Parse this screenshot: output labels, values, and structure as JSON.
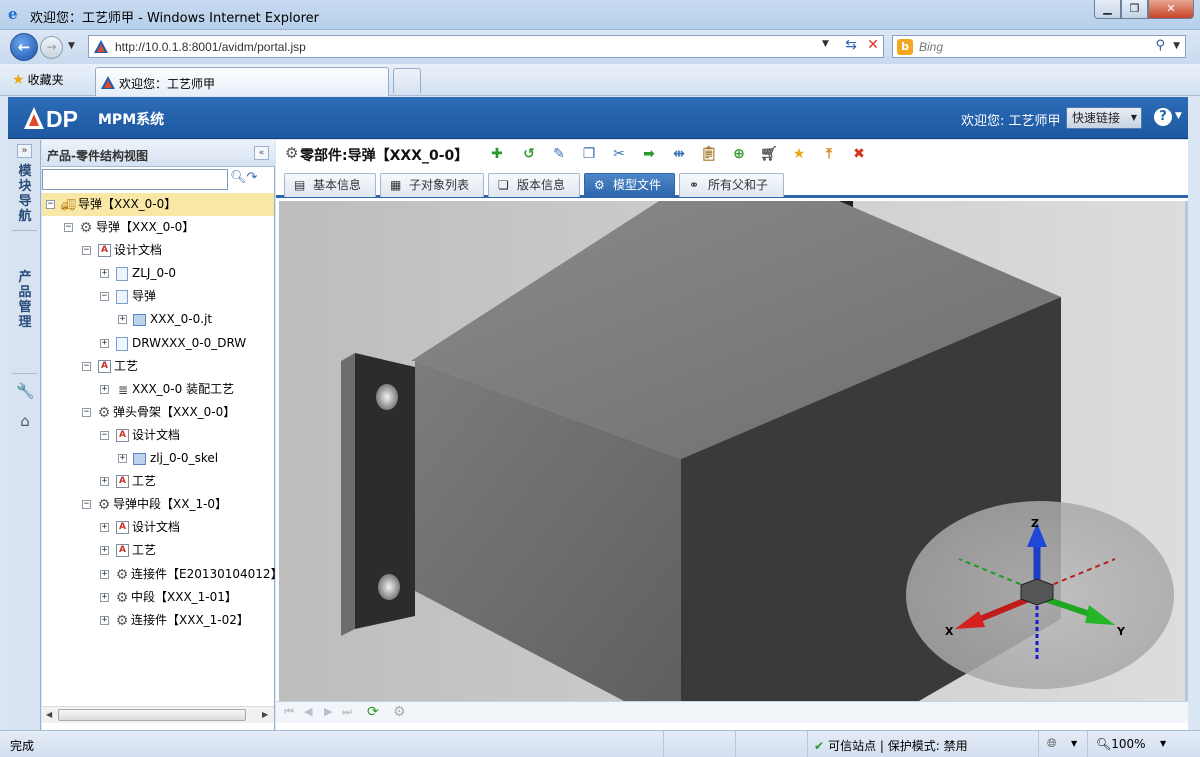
{
  "browser": {
    "window_title": "欢迎您：工艺师甲 - Windows Internet Explorer",
    "url": "http://10.0.1.8:8001/avidm/portal.jsp",
    "search_placeholder": "Bing",
    "favorites_label": "收藏夹",
    "tab_title": "欢迎您：工艺师甲",
    "status_done": "完成",
    "status_zone": "可信站点 | 保护模式: 禁用",
    "zoom": "100%",
    "brand_color": "#2c6cb7"
  },
  "app": {
    "logo_text": "DP",
    "name": "MPM系统",
    "welcome": "欢迎您: 工艺师甲",
    "quick_links": "快速链接",
    "help_icon": "help-icon"
  },
  "rail": {
    "module_nav": "模块导航",
    "product_mgmt": "产品管理"
  },
  "tree_panel": {
    "title": "产品-零件结构视图",
    "search_value": "",
    "nodes": [
      {
        "label": "导弹【XXX_0-0】",
        "icon": "truck-icon"
      },
      {
        "label": "导弹【XXX_0-0】",
        "icon": "gear-icon"
      },
      {
        "label": "设计文档",
        "icon": "document-folder-icon"
      },
      {
        "label": "ZLJ_0-0",
        "icon": "file-icon"
      },
      {
        "label": "导弹",
        "icon": "file-icon"
      },
      {
        "label": "XXX_0-0.jt",
        "icon": "part-file-icon"
      },
      {
        "label": "DRWXXX_0-0_DRW",
        "icon": "file-icon"
      },
      {
        "label": "工艺",
        "icon": "document-folder-icon"
      },
      {
        "label": "XXX_0-0 装配工艺",
        "icon": "list-icon"
      },
      {
        "label": "弹头骨架【XXX_0-0】",
        "icon": "gear-icon"
      },
      {
        "label": "设计文档",
        "icon": "document-folder-icon"
      },
      {
        "label": "zlj_0-0_skel",
        "icon": "part-file-icon"
      },
      {
        "label": "工艺",
        "icon": "document-folder-icon"
      },
      {
        "label": "导弹中段【XX_1-0】",
        "icon": "gear-icon"
      },
      {
        "label": "设计文档",
        "icon": "document-folder-icon"
      },
      {
        "label": "工艺",
        "icon": "document-folder-icon"
      },
      {
        "label": "连接件【E20130104012】",
        "icon": "gear-icon"
      },
      {
        "label": "中段【XXX_1-01】",
        "icon": "gear-icon"
      },
      {
        "label": "连接件【XXX_1-02】",
        "icon": "gear-icon"
      }
    ]
  },
  "main": {
    "part_title": "零部件:导弹【XXX_0-0】",
    "toolbar_icons": [
      "add-icon",
      "undo-icon",
      "edit-icon",
      "copy-icon",
      "cut-icon",
      "move-icon",
      "compare-icon",
      "paste-icon",
      "plus-circle-icon",
      "cart-icon",
      "favorite-star-icon",
      "export-icon",
      "delete-icon"
    ],
    "tabs": [
      {
        "label": "基本信息",
        "icon": "info-icon"
      },
      {
        "label": "子对象列表",
        "icon": "table-icon"
      },
      {
        "label": "版本信息",
        "icon": "version-icon"
      },
      {
        "label": "模型文件",
        "icon": "gear-icon"
      },
      {
        "label": "所有父和子",
        "icon": "relations-icon"
      }
    ],
    "active_tab": "模型文件",
    "axis_labels": {
      "x": "X",
      "y": "Y",
      "z": "Z"
    }
  }
}
